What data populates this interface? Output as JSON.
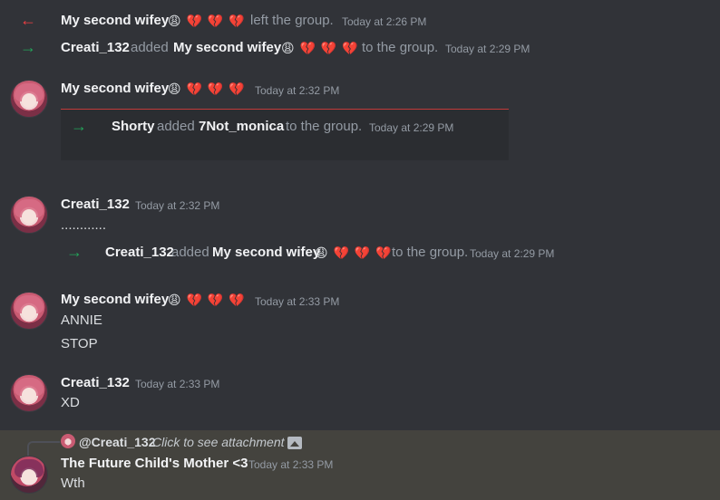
{
  "events": [
    {
      "type": "leave",
      "user": "My second wifey",
      "emoji": "😩 💔 💔 💔",
      "text": "left the group.",
      "time": "Today at 2:26 PM"
    },
    {
      "type": "add",
      "actor": "Creati_132",
      "verb": "added",
      "target": "My second wifey",
      "emoji": "😩 💔 💔 💔",
      "text": "to the group.",
      "time": "Today at 2:29 PM"
    }
  ],
  "messages": [
    {
      "author": "My second wifey",
      "emoji": "😩 💔 💔 💔",
      "time": "Today at 2:32 PM",
      "embed": {
        "actor": "Shorty",
        "verb": "added",
        "target": "7Not_monica",
        "text": "to the group.",
        "time": "Today at 2:29 PM"
      }
    },
    {
      "author": "Creati_132",
      "time": "Today at 2:32 PM",
      "line": "............",
      "embed": {
        "actor": "Creati_132",
        "verb": "added",
        "target": "My second wifey",
        "emoji": "😩 💔 💔 💔",
        "text": "to the group.",
        "time": "Today at 2:29 PM"
      }
    },
    {
      "author": "My second wifey",
      "emoji": "😩 💔 💔 💔",
      "time": "Today at 2:33 PM",
      "lines": [
        "ANNIE",
        "STOP"
      ]
    },
    {
      "author": "Creati_132",
      "time": "Today at 2:33 PM",
      "lines": [
        "XD"
      ]
    },
    {
      "reply": {
        "mention": "@Creati_132",
        "text": "Click to see attachment"
      },
      "author": "The Future Child's Mother <3",
      "time": "Today at 2:33 PM",
      "lines": [
        "Wth"
      ]
    }
  ]
}
